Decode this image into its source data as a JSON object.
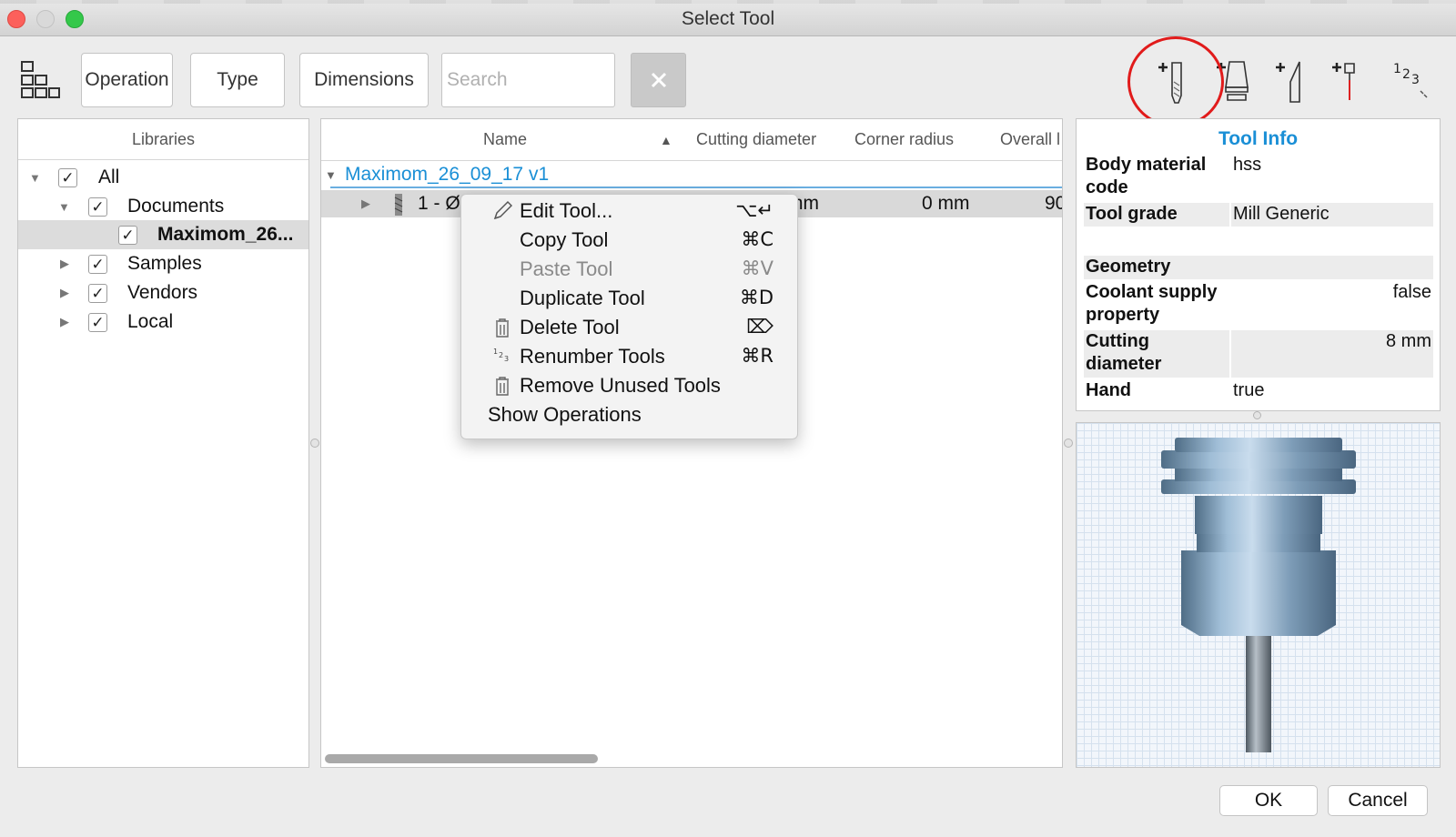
{
  "window": {
    "title": "Select Tool"
  },
  "toolbar": {
    "operation_label": "Operation",
    "type_label": "Type",
    "dimensions_label": "Dimensions",
    "search_placeholder": "Search"
  },
  "libraries": {
    "header": "Libraries",
    "items": [
      {
        "label": "All",
        "checked": true
      },
      {
        "label": "Documents",
        "checked": true
      },
      {
        "label": "Maximom_26...",
        "checked": true
      },
      {
        "label": "Samples",
        "checked": true
      },
      {
        "label": "Vendors",
        "checked": true
      },
      {
        "label": "Local",
        "checked": true
      }
    ]
  },
  "table": {
    "columns": [
      "Name",
      "Cutting diameter",
      "Corner radius",
      "Overall l"
    ],
    "sort_arrow": "▲",
    "group": "Maximom_26_09_17 v1",
    "row": {
      "name": "1 - Ø8",
      "cutting_diameter": "mm",
      "corner_radius": "0 mm",
      "overall": "90"
    }
  },
  "context_menu": {
    "items": [
      {
        "label": "Edit Tool...",
        "shortcut": "⌥↵",
        "icon": "pencil-icon"
      },
      {
        "label": "Copy Tool",
        "shortcut": "⌘C"
      },
      {
        "label": "Paste Tool",
        "shortcut": "⌘V",
        "disabled": true
      },
      {
        "label": "Duplicate Tool",
        "shortcut": "⌘D"
      },
      {
        "label": "Delete Tool",
        "shortcut": "⌦",
        "icon": "trash-icon"
      },
      {
        "label": "Renumber Tools",
        "shortcut": "⌘R",
        "icon": "renumber-icon"
      },
      {
        "label": "Remove Unused Tools",
        "icon": "trash-icon"
      },
      {
        "label": "Show Operations"
      }
    ]
  },
  "tool_info": {
    "title": "Tool Info",
    "rows": [
      {
        "key1": "Body material",
        "key2": "code",
        "value": "hss"
      },
      {
        "key1": "Tool grade",
        "value": "Mill Generic"
      },
      {
        "key1": "Geometry"
      },
      {
        "key1": "Coolant supply",
        "key2": "property",
        "value": "false"
      },
      {
        "key1": "Cutting",
        "key2": "diameter",
        "value": "8 mm"
      },
      {
        "key1": "Hand",
        "value": "true"
      }
    ]
  },
  "dialog": {
    "ok_label": "OK",
    "cancel_label": "Cancel"
  },
  "colors": {
    "accent": "#1a8fd6",
    "highlight_circle": "#e11b1b"
  }
}
